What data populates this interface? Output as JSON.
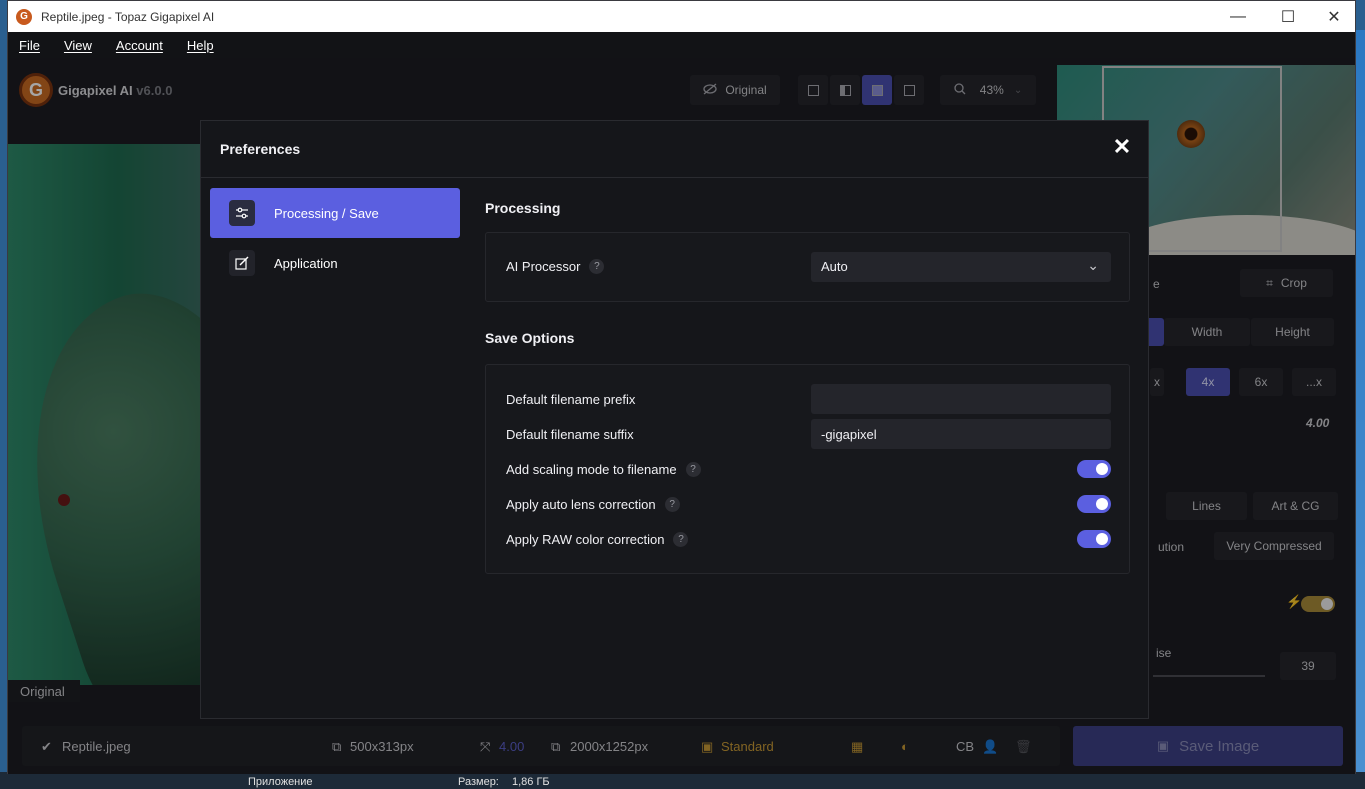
{
  "window": {
    "title": "Reptile.jpeg - Topaz Gigapixel AI",
    "minimize": "—",
    "maximize": "☐",
    "close": "✕"
  },
  "menu": [
    "File",
    "View",
    "Account",
    "Help"
  ],
  "app": {
    "logo_letter": "G",
    "name": "Gigapixel AI",
    "version": "v6.0.0",
    "original_toggle": "Original",
    "zoom": "43%",
    "preview_label": "Original"
  },
  "right_panel": {
    "scale_label_fragment": "e",
    "crop": "Crop",
    "dimension_tabs": [
      "Width",
      "Height"
    ],
    "scale_buttons": [
      "x",
      "4x",
      "6x",
      "...x"
    ],
    "scale_value": "4.00",
    "model_buttons": [
      "Lines",
      "Art & CG"
    ],
    "quality_fragment": "ution",
    "quality_option": "Very Compressed",
    "noise_fragment": "ise",
    "noise_value": "39"
  },
  "bottom_bar": {
    "filename": "Reptile.jpeg",
    "input_size": "500x313px",
    "scale": "4.00",
    "output_size": "2000x1252px",
    "mode": "Standard",
    "color": "CB",
    "save_button": "Save Image"
  },
  "dialog": {
    "title": "Preferences",
    "close": "✕",
    "nav": [
      {
        "label": "Processing / Save",
        "icon": "sliders-icon",
        "active": true
      },
      {
        "label": "Application",
        "icon": "edit-icon",
        "active": false
      }
    ],
    "processing": {
      "heading": "Processing",
      "ai_processor_label": "AI Processor",
      "ai_processor_value": "Auto"
    },
    "save_options": {
      "heading": "Save Options",
      "prefix_label": "Default filename prefix",
      "prefix_value": "",
      "suffix_label": "Default filename suffix",
      "suffix_value": "-gigapixel",
      "toggles": [
        {
          "label": "Add scaling mode to filename",
          "on": true
        },
        {
          "label": "Apply auto lens correction",
          "on": true
        },
        {
          "label": "Apply RAW color correction",
          "on": true
        }
      ]
    }
  },
  "desktop": {
    "text1": "Приложение",
    "text2": "Размер:",
    "text3": "1,86 ГБ"
  }
}
